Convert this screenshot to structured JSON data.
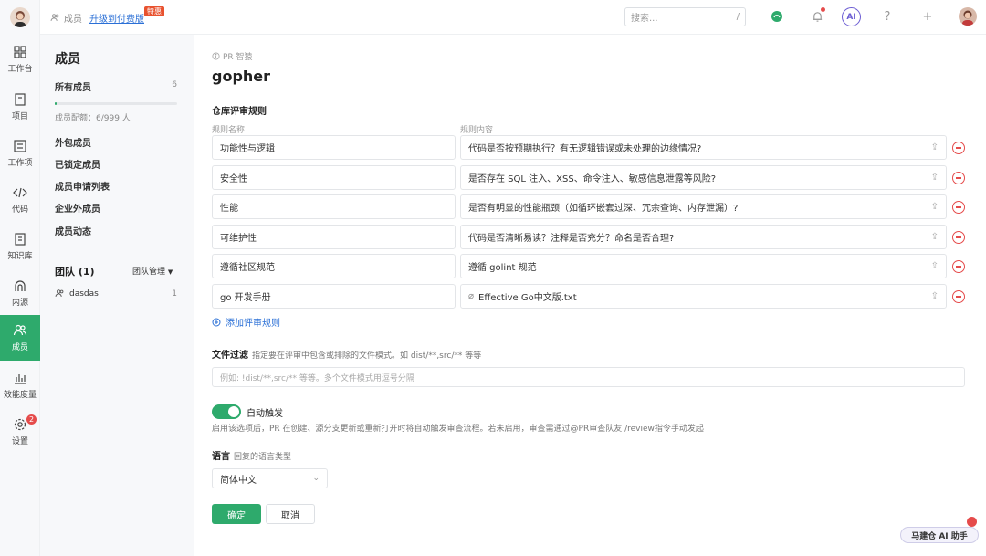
{
  "topbar": {
    "crumb": "成员",
    "upgrade": "升级到付费版",
    "hot_tag": "特惠",
    "search_placeholder": "搜索...",
    "search_shortcut": "/",
    "ai_label": "AI"
  },
  "rail": {
    "items": [
      {
        "label": "工作台",
        "icon": "dashboard-icon"
      },
      {
        "label": "项目",
        "icon": "project-icon"
      },
      {
        "label": "工作项",
        "icon": "task-icon"
      },
      {
        "label": "代码",
        "icon": "code-icon"
      },
      {
        "label": "知识库",
        "icon": "book-icon"
      },
      {
        "label": "内源",
        "icon": "inner-source-icon"
      },
      {
        "label": "成员",
        "icon": "members-icon",
        "active": true
      },
      {
        "label": "效能度量",
        "icon": "chart-icon"
      },
      {
        "label": "设置",
        "icon": "gear-icon",
        "badge": "2"
      }
    ]
  },
  "panel": {
    "title": "成员",
    "all_members": "所有成员",
    "all_members_count": "6",
    "quota_text": "成员配额：6/999 人",
    "quota_fraction": 0.006,
    "items": [
      "外包成员",
      "已锁定成员",
      "成员申请列表",
      "企业外成员",
      "成员动态"
    ],
    "team_title": "团队 (1)",
    "team_manage": "团队管理",
    "teams": [
      {
        "name": "dasdas",
        "count": "1"
      }
    ]
  },
  "main": {
    "sub_crumb": "PR 智猿",
    "title": "gopher",
    "section_title": "仓库评审规则",
    "col_name": "规则名称",
    "col_content": "规则内容",
    "rules": [
      {
        "name": "功能性与逻辑",
        "content": "代码是否按预期执行？有无逻辑错误或未处理的边缘情况?"
      },
      {
        "name": "安全性",
        "content": "是否存在 SQL 注入、XSS、命令注入、敏感信息泄露等风险?"
      },
      {
        "name": "性能",
        "content": "是否有明显的性能瓶颈（如循环嵌套过深、冗余查询、内存泄漏）?"
      },
      {
        "name": "可维护性",
        "content": "代码是否清晰易读？注释是否充分？命名是否合理?"
      },
      {
        "name": "遵循社区规范",
        "content": "遵循 golint 规范"
      },
      {
        "name": "go 开发手册",
        "content": "Effective Go中文版.txt",
        "is_file": true
      }
    ],
    "add_rule": "添加评审规则",
    "file_filter_label": "文件过滤",
    "file_filter_desc": "指定要在评审中包含或排除的文件模式。如 dist/**,src/** 等等",
    "file_filter_placeholder": "例如: !dist/**,src/** 等等。多个文件模式用逗号分隔",
    "auto_trigger_label": "自动触发",
    "auto_trigger_enabled": true,
    "auto_trigger_desc": "启用该选项后，PR 在创建、源分支更新或重新打开时将自动触发审查流程。若未启用，审查需通过@PR审查队友 /review指令手动发起",
    "lang_label": "语言",
    "lang_desc": "回复的语言类型",
    "lang_value": "简体中文",
    "ok": "确定",
    "cancel": "取消"
  },
  "assistant": "马建仓 AI 助手"
}
